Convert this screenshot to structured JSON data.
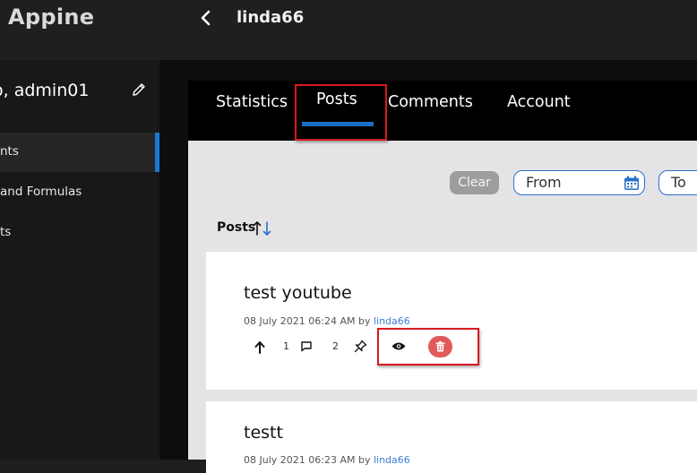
{
  "app": {
    "name": "Appine",
    "page_title": "linda66"
  },
  "sidebar": {
    "greeting": "o, admin01",
    "items": [
      {
        "label": "nts",
        "active": true
      },
      {
        "label": "and Formulas",
        "active": false
      },
      {
        "label": "ts",
        "active": false
      }
    ]
  },
  "tabs": [
    {
      "label": "Statistics",
      "active": false
    },
    {
      "label": "Posts",
      "active": true
    },
    {
      "label": "Comments",
      "active": false
    },
    {
      "label": "Account",
      "active": false
    }
  ],
  "filters": {
    "clear_label": "Clear",
    "from_label": "From",
    "to_label": "To"
  },
  "list": {
    "sort_label": "Posts"
  },
  "posts": [
    {
      "title": "test youtube",
      "date": "08 July 2021 06:24 AM by",
      "author": "linda66",
      "upvotes": "1",
      "comments": "2"
    },
    {
      "title": "testt",
      "date": "08 July 2021 06:23 AM by",
      "author": "linda66"
    }
  ],
  "colors": {
    "accent": "#1a6fc4",
    "highlight": "#d81920",
    "delete": "#e05a5a",
    "link": "#3d7fd6"
  }
}
